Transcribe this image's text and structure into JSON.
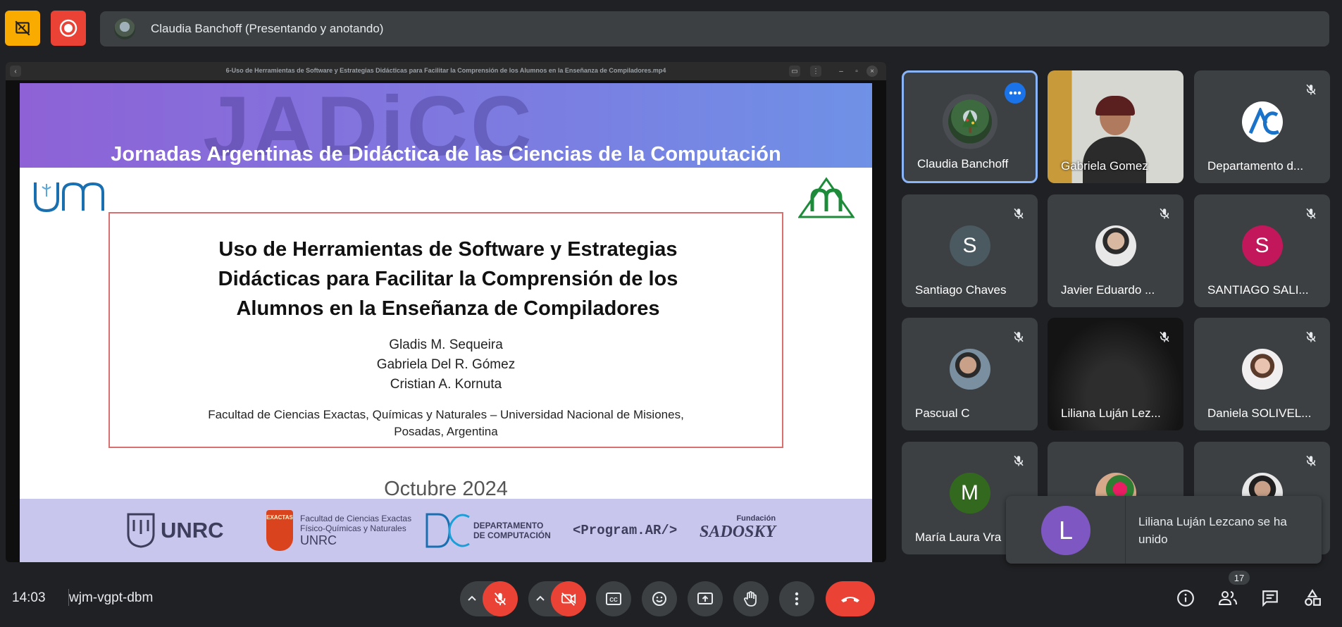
{
  "top_bar": {
    "presenter_text": "Claudia Banchoff (Presentando y anotando)",
    "colors": {
      "annotate_button": "#f9ab00",
      "record_button": "#ea4335"
    }
  },
  "shared_window": {
    "title": "6-Uso de Herramientas de Software y Estrategias Didácticas para Facilitar la Comprensión de los Alumnos en la Enseñanza de Compiladores.mp4"
  },
  "slide": {
    "watermark": "JADiCC",
    "header": "Jornadas Argentinas de Didáctica de las Ciencias de la Computación",
    "title_lines": [
      "Uso de Herramientas de Software y Estrategias",
      "Didácticas para Facilitar la Comprensión de los",
      "Alumnos en la Enseñanza de Compiladores"
    ],
    "authors": [
      "Gladis M. Sequeira",
      "Gabriela Del R. Gómez",
      "Cristian A. Kornuta"
    ],
    "affiliation_lines": [
      "Facultad de Ciencias Exactas, Químicas y Naturales – Universidad Nacional de Misiones,",
      "Posadas, Argentina"
    ],
    "date": "Octubre 2024",
    "left_logo": "unm",
    "footer_logos": {
      "unrc": "UNRC",
      "exactas_top": "EXACTAS",
      "exactas_text_1": "Facultad de Ciencias Exactas",
      "exactas_text_2": "Físico-Químicas y Naturales",
      "exactas_text_3": "UNRC",
      "dc_1": "DEPARTAMENTO",
      "dc_2": "DE COMPUTACIÓN",
      "program_ar": "<Program.AR/>",
      "sadosky_small": "Fundación",
      "sadosky": "SADOSKY"
    }
  },
  "participants": [
    {
      "name": "Claudia Banchoff",
      "avatar": "tree-photo",
      "muted": false,
      "active": true
    },
    {
      "name": "Gabriela Gomez",
      "avatar": "video",
      "muted": false
    },
    {
      "name": "Departamento d...",
      "avatar": "logo",
      "muted": true
    },
    {
      "name": "Santiago Chaves",
      "avatar": "S",
      "muted": true,
      "color": "#4b5961"
    },
    {
      "name": "Javier Eduardo ...",
      "avatar": "photo",
      "muted": true
    },
    {
      "name": "SANTIAGO SALI...",
      "avatar": "S",
      "muted": true,
      "color": "#c2185b"
    },
    {
      "name": "Pascual C",
      "avatar": "photo",
      "muted": true
    },
    {
      "name": "Liliana Luján Lez...",
      "avatar": "video-dark",
      "muted": true
    },
    {
      "name": "Daniela SOLIVEL...",
      "avatar": "photo",
      "muted": true
    },
    {
      "name": "María Laura Vra",
      "avatar": "M",
      "muted": true,
      "color": "#33691e"
    },
    {
      "name": "",
      "avatar": "photo",
      "muted": false
    },
    {
      "name": "",
      "avatar": "photo",
      "muted": true
    }
  ],
  "toast": {
    "initial": "L",
    "message": "Liliana Luján Lezcano se ha unido"
  },
  "bottom_bar": {
    "time": "14:03",
    "meeting_code": "wjm-vgpt-dbm",
    "people_count": "17",
    "colors": {
      "end_call": "#ea4335",
      "muted": "#ea4335"
    }
  }
}
